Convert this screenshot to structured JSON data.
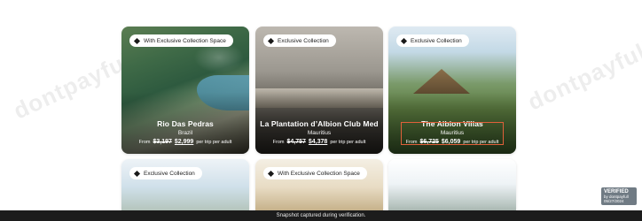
{
  "cards": [
    {
      "badge": "With Exclusive Collection Space",
      "title": "Rio Das Pedras",
      "location": "Brazil",
      "from": "From",
      "old_price": "$3,197",
      "new_price": "$2,999",
      "suffix": "per trip per adult"
    },
    {
      "badge": "Exclusive Collection",
      "title": "La Plantation d’Albion Club Med",
      "location": "Mauritius",
      "from": "From",
      "old_price": "$4,757",
      "new_price": "$4,378",
      "suffix": "per trip per adult"
    },
    {
      "badge": "Exclusive Collection",
      "title": "The Albion Villas",
      "location": "Mauritius",
      "from": "From",
      "old_price": "$6,725",
      "new_price": "$6,059",
      "suffix": "per trip per adult"
    },
    {
      "badge": "Exclusive Collection"
    },
    {
      "badge": "With Exclusive Collection Space"
    }
  ],
  "watermark": "dontpayfull",
  "verified": {
    "title": "VERIFIED",
    "line1": "by dontpayfull",
    "line2": "05/27/2024"
  },
  "snapshot_text": "Snapshot captured during verification.",
  "colors": {
    "highlight": "#e0603a",
    "bottom_bar": "#1c1c1c"
  }
}
